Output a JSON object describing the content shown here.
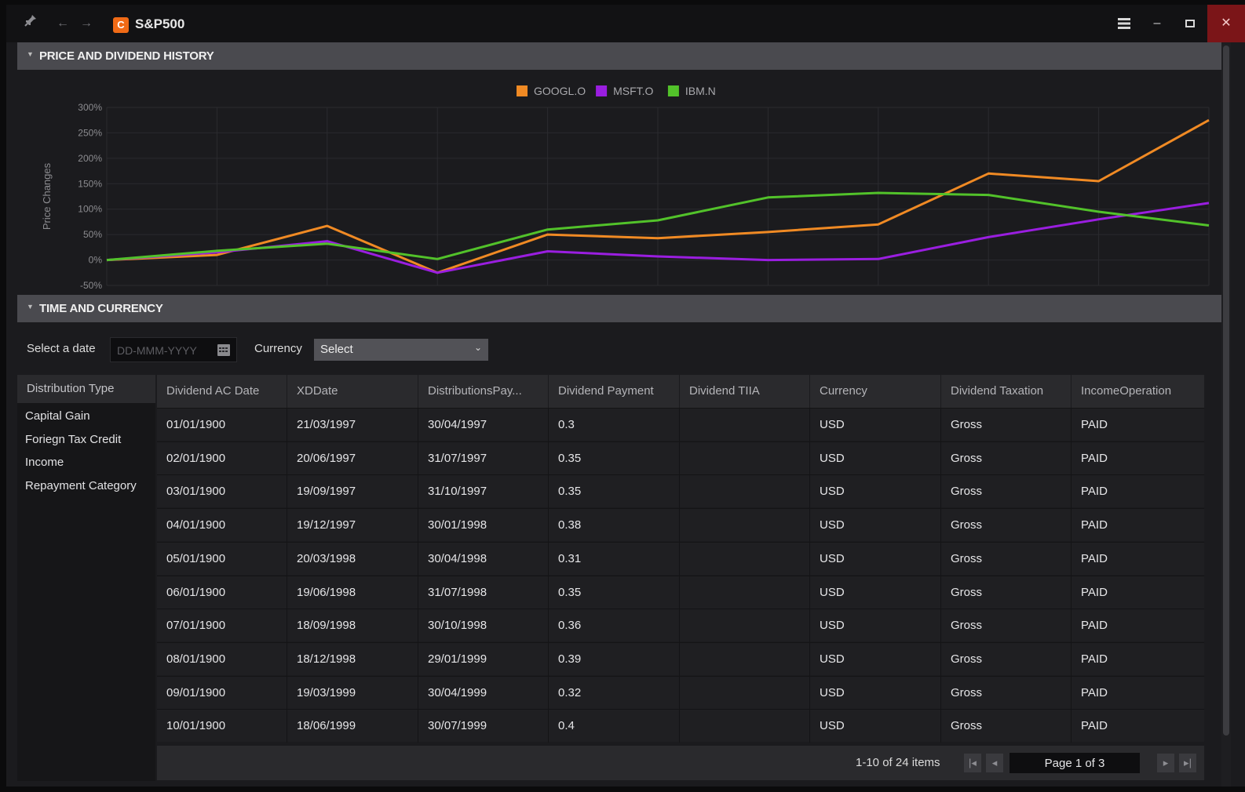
{
  "app": {
    "title": "S&P500",
    "logo_letter": "C"
  },
  "sections": {
    "chart": "PRICE AND DIVIDEND HISTORY",
    "time_currency": "TIME AND CURRENCY"
  },
  "filters": {
    "date_label": "Select a date",
    "date_placeholder": "DD-MMM-YYYY",
    "currency_label": "Currency",
    "currency_value": "Select"
  },
  "distribution": {
    "header": "Distribution Type",
    "items": [
      "Capital Gain",
      "Foriegn Tax Credit",
      "Income",
      "Repayment Category"
    ]
  },
  "table": {
    "columns": [
      "Dividend AC Date",
      "XDDate",
      "DistributionsPay...",
      "Dividend Payment",
      "Dividend TIIA",
      "Currency",
      "Dividend Taxation",
      "IncomeOperation"
    ],
    "rows": [
      [
        "01/01/1900",
        "21/03/1997",
        "30/04/1997",
        "0.3",
        "",
        "USD",
        "Gross",
        "PAID"
      ],
      [
        "02/01/1900",
        "20/06/1997",
        "31/07/1997",
        "0.35",
        "",
        "USD",
        "Gross",
        "PAID"
      ],
      [
        "03/01/1900",
        "19/09/1997",
        "31/10/1997",
        "0.35",
        "",
        "USD",
        "Gross",
        "PAID"
      ],
      [
        "04/01/1900",
        "19/12/1997",
        "30/01/1998",
        "0.38",
        "",
        "USD",
        "Gross",
        "PAID"
      ],
      [
        "05/01/1900",
        "20/03/1998",
        "30/04/1998",
        "0.31",
        "",
        "USD",
        "Gross",
        "PAID"
      ],
      [
        "06/01/1900",
        "19/06/1998",
        "31/07/1998",
        "0.35",
        "",
        "USD",
        "Gross",
        "PAID"
      ],
      [
        "07/01/1900",
        "18/09/1998",
        "30/10/1998",
        "0.36",
        "",
        "USD",
        "Gross",
        "PAID"
      ],
      [
        "08/01/1900",
        "18/12/1998",
        "29/01/1999",
        "0.39",
        "",
        "USD",
        "Gross",
        "PAID"
      ],
      [
        "09/01/1900",
        "19/03/1999",
        "30/04/1999",
        "0.32",
        "",
        "USD",
        "Gross",
        "PAID"
      ],
      [
        "10/01/1900",
        "18/06/1999",
        "30/07/1999",
        "0.4",
        "",
        "USD",
        "Gross",
        "PAID"
      ]
    ]
  },
  "pager": {
    "info": "1-10 of 24 items",
    "page_text": "Page 1 of 3"
  },
  "colors": {
    "googl": "#f08a24",
    "msft": "#9a1ee0",
    "ibm": "#52c22a",
    "close": "#7b1518"
  },
  "icons": {
    "pin": "pin-icon",
    "back": "back-arrow-icon",
    "forward": "forward-arrow-icon",
    "menu": "hamburger-menu-icon",
    "minimize": "minimize-icon",
    "maximize": "maximize-icon",
    "close": "close-icon"
  },
  "chart_data": {
    "type": "line",
    "ylabel": "Price Changes",
    "ylim": [
      -50,
      300
    ],
    "yticks": [
      "300%",
      "250%",
      "200%",
      "150%",
      "100%",
      "50%",
      "0%",
      "-50%"
    ],
    "x": [
      0,
      1,
      2,
      3,
      4,
      5,
      6,
      7,
      8,
      9,
      10
    ],
    "grid": true,
    "legend_position": "top-center",
    "series": [
      {
        "name": "GOOGL.O",
        "color": "#f08a24",
        "values": [
          0,
          10,
          67,
          -25,
          50,
          43,
          55,
          70,
          170,
          155,
          275
        ]
      },
      {
        "name": "MSFT.O",
        "color": "#9a1ee0",
        "values": [
          0,
          15,
          37,
          -25,
          17,
          7,
          0,
          2,
          45,
          80,
          112
        ]
      },
      {
        "name": "IBM.N",
        "color": "#52c22a",
        "values": [
          0,
          18,
          32,
          2,
          60,
          78,
          123,
          132,
          128,
          95,
          68
        ]
      }
    ]
  }
}
